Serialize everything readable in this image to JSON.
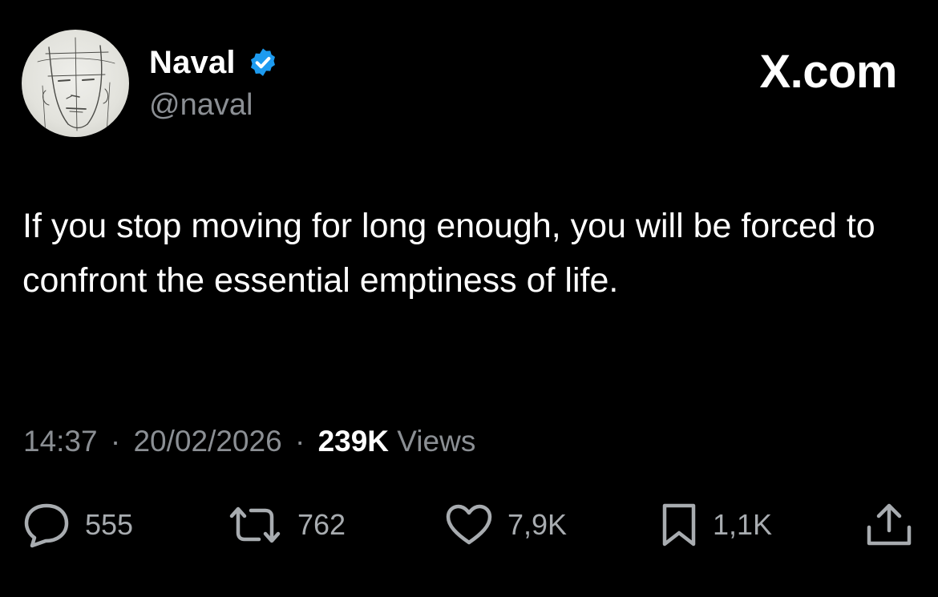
{
  "header": {
    "display_name": "Naval",
    "handle": "@naval",
    "brand": "X.com",
    "verified_color": "#1d9bf0"
  },
  "tweet": {
    "text": "If you stop moving for long enough, you will be forced to confront the essential emptiness of life."
  },
  "meta": {
    "time": "14:37",
    "separator": "·",
    "date": "20/02/2026",
    "views_count": "239K",
    "views_label": "Views"
  },
  "actions": {
    "replies": "555",
    "reposts": "762",
    "likes": "7,9K",
    "bookmarks": "1,1K"
  },
  "icons": {
    "avatar": "pencil-sketch-face-avatar",
    "verified": "verified-badge-icon",
    "reply": "speech-bubble-icon",
    "repost": "repost-arrows-icon",
    "like": "heart-icon",
    "bookmark": "bookmark-icon",
    "share": "share-upload-icon"
  }
}
